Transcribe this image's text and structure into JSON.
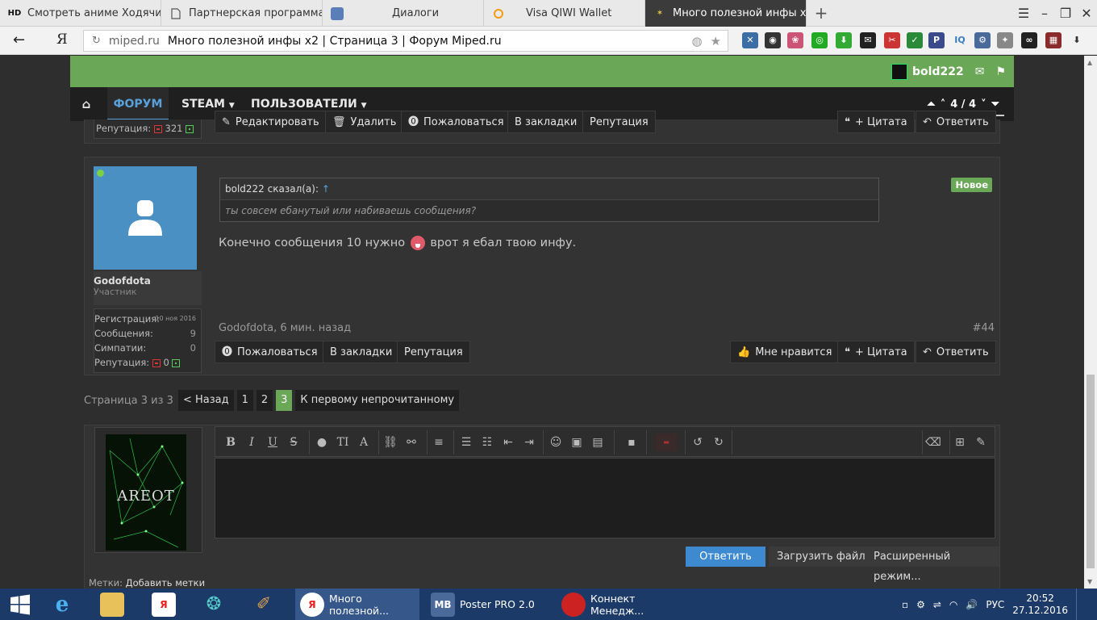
{
  "browser": {
    "tabs": [
      {
        "label": "Смотреть аниме Ходячий з",
        "icon": "HD"
      },
      {
        "label": "Партнерская программа по",
        "icon": "doc"
      },
      {
        "label": "Диалоги",
        "icon": "chat"
      },
      {
        "label": "Visa QIWI Wallet",
        "icon": "qiwi"
      },
      {
        "label": "Много полезной инфы х",
        "icon": "mip"
      }
    ],
    "url_domain": "miped.ru",
    "url_title": "Много полезной инфы x2 | Страница 3 | Форум Miped.ru",
    "yandex_label": "Я"
  },
  "site": {
    "username": "bold222",
    "nav": {
      "forum": "ФОРУМ",
      "steam": "STEAM",
      "users": "ПОЛЬЗОВАТЕЛИ"
    },
    "page_counter": "4 / 4"
  },
  "prev_post": {
    "rep_label": "Репутация:",
    "rep_value": "321",
    "buttons": {
      "edit": "Редактировать",
      "delete": "Удалить",
      "report": "Пожаловаться",
      "bookmark": "В закладки",
      "rep": "Репутация",
      "quote": "+ Цитата",
      "reply": "Ответить"
    }
  },
  "post": {
    "author": "Godofdota",
    "role": "Участник",
    "stats": [
      {
        "label": "Регистрация:",
        "value": "10 ноя 2016"
      },
      {
        "label": "Сообщения:",
        "value": "9"
      },
      {
        "label": "Симпатии:",
        "value": "0"
      }
    ],
    "rep_label": "Репутация:",
    "rep_value": "0",
    "quote_author": "bold222 сказал(а):",
    "quote_arrow": "↑",
    "quote_text": "ты совсем ебанутый или набиваешь сообщения?",
    "badge": "Новое",
    "text_before": "Конечно сообщения 10 нужно",
    "text_after": "врот я ебал твою инфу.",
    "meta": "Godofdota, 6 мин. назад",
    "number": "#44",
    "buttons": {
      "report": "Пожаловаться",
      "bookmark": "В закладки",
      "rep": "Репутация",
      "like": "Мне нравится",
      "quote": "+ Цитата",
      "reply": "Ответить"
    }
  },
  "pagination": {
    "info": "Страница 3 из 3",
    "prev": "< Назад",
    "pages": [
      "1",
      "2",
      "3"
    ],
    "current": "3",
    "first_unread": "К первому непрочитанному"
  },
  "reply_form": {
    "avatar_text": "AREOT",
    "submit": "Ответить",
    "upload": "Загрузить файл",
    "advanced": "Расширенный режим...",
    "tags_label": "Метки:",
    "tags_link": "Добавить метки"
  },
  "taskbar": {
    "apps": [
      {
        "label": "Много полезной..."
      },
      {
        "label": "Poster PRO 2.0"
      },
      {
        "label": "Коннект Менедж..."
      }
    ],
    "lang": "РУС",
    "time": "20:52",
    "date": "27.12.2016"
  },
  "colors": {
    "accent_green": "#6aa756",
    "accent_blue": "#5aa0d8",
    "taskbar": "#1c3a67"
  }
}
